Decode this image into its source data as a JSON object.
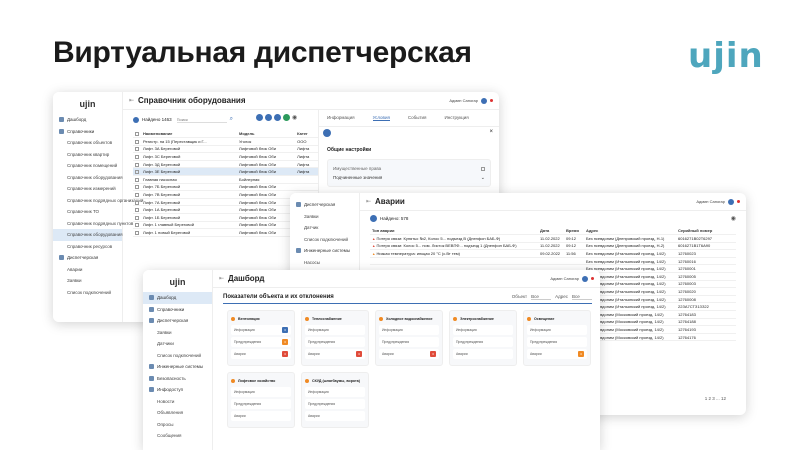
{
  "slide": {
    "title": "Виртуальная диспетчерская",
    "logo": "ujin"
  },
  "colors": {
    "accent": "#3d6fb4",
    "brand": "#4ea6bd",
    "orange": "#f08a24",
    "red": "#e04b3a",
    "blue": "#3d6fb4"
  },
  "w1": {
    "logo": "ujin",
    "title": "Справочник оборудования",
    "user": "Админ Сапогар",
    "search_label": "Найдено 1463",
    "search_placeholder": "Поиск",
    "sidebar": [
      {
        "label": "Дашборд",
        "icon": "dashboard-icon",
        "sub": false,
        "active": false
      },
      {
        "label": "Справочники",
        "icon": "book-icon",
        "sub": false,
        "active": false
      },
      {
        "label": "Справочник объектов",
        "sub": true,
        "active": false
      },
      {
        "label": "Справочник квартир",
        "sub": true,
        "active": false
      },
      {
        "label": "Справочник помещений",
        "sub": true,
        "active": false
      },
      {
        "label": "Справочник оборудования",
        "sub": true,
        "active": false
      },
      {
        "label": "Справочник измерений",
        "sub": true,
        "active": false
      },
      {
        "label": "Справочник подрядных организаций",
        "sub": true,
        "active": false
      },
      {
        "label": "Справочник ТО",
        "sub": true,
        "active": false
      },
      {
        "label": "Справочник подрядных пунктов",
        "sub": true,
        "active": false
      },
      {
        "label": "Справочник оборудования",
        "sub": true,
        "active": true
      },
      {
        "label": "Справочник ресурсов",
        "sub": true,
        "active": false
      },
      {
        "label": "Диспетчерская",
        "icon": "monitor-icon",
        "sub": false,
        "active": false
      },
      {
        "label": "Аварии",
        "sub": true,
        "active": false
      },
      {
        "label": "Заявки",
        "sub": true,
        "active": false
      },
      {
        "label": "Список подключений",
        "sub": true,
        "active": false
      }
    ],
    "columns": [
      "Наименование",
      "Модель",
      "Катег"
    ],
    "rows": [
      [
        "Регистр. на 15 (Переставщик и Г...",
        "Уголок",
        "ООО"
      ],
      [
        "Лифт. 3А Береговой",
        "Лифтовой блок Оби",
        "Лифта"
      ],
      [
        "Лифт. 3С Береговой",
        "Лифтовой блок Оби",
        "Лифта"
      ],
      [
        "Лифт. 3Д Береговой",
        "Лифтовой блок Оби",
        "Лифта"
      ],
      [
        "Лифт. 3Е Береговой",
        "Лифтовой блок Оби",
        "Лифта"
      ],
      [
        "Главная насосная",
        "Бойлерная",
        ""
      ],
      [
        "Лифт. 7Б Береговой",
        "Лифтовой блок Оби",
        ""
      ],
      [
        "Лифт. 7В Береговой",
        "Лифтовой блок Оби",
        ""
      ],
      [
        "Лифт. 7А Береговой",
        "Лифтовой блок Оби",
        ""
      ],
      [
        "Лифт. 1А Береговой",
        "Лифтовой блок Оби",
        ""
      ],
      [
        "Лифт. 1Б Береговой",
        "Лифтовой блок Оби",
        ""
      ],
      [
        "Лифт. 1 главный Береговой",
        "Лифтовой блок Оби",
        ""
      ],
      [
        "Лифт. 1 новый Береговой",
        "Лифтовой блок Оби",
        ""
      ]
    ],
    "panel": {
      "tabs": [
        "Информация",
        "Условия",
        "События",
        "Инструкция"
      ],
      "heading": "Общие настройки",
      "field1": "Имущественные права",
      "field2": "Подчиненные значения"
    }
  },
  "w2": {
    "title": "Аварии",
    "user": "Админ Сапогар",
    "found": "Найдено: 578",
    "sidebar": [
      {
        "label": "Диспетчерская",
        "sub": false
      },
      {
        "label": "Заявки",
        "sub": true
      },
      {
        "label": "Датчик",
        "sub": true
      },
      {
        "label": "Список подключений",
        "sub": true
      },
      {
        "label": "Инженерные системы",
        "sub": false
      },
      {
        "label": "Насосы",
        "sub": true
      }
    ],
    "columns": [
      "Тип аварии",
      "Дата",
      "Время",
      "Адрес",
      "Серийный номер"
    ],
    "rows": [
      [
        "Потеря связи: Кунятьо №2, Колос 5... подъезд В (Днепфон БАБ-Ф)",
        "11.02.2022",
        "09:12",
        "Без псевдоним (Днепровский проезд, Н-1)",
        "6016271В02Т6297"
      ],
      [
        "Потеря связи: Колос 5... пом. Листок ВЕВПФ... подъезд 1 (Днепфон БАБ-Ф)",
        "11.02.2022",
        "09:12",
        "Без псевдоним (Днепровский проезд, Н-2)",
        "6016271В1Т6А90"
      ],
      [
        "Низкая температура: инкцая 20 °C (с.Вт тем)",
        "09.02.2022",
        "11:56",
        "Без псевдоним (Итальянский проезд, 14/2)",
        "12760023"
      ],
      [
        "",
        "",
        "",
        "Без псевдоним (Итальянский проезд, 14/2)",
        "12760016"
      ],
      [
        "",
        "",
        "",
        "Без псевдоним (Итальянский проезд, 14/2)",
        "12760001"
      ],
      [
        "",
        "",
        "",
        "Без псевдоним (Итальянский проезд, 14/2)",
        "12760005"
      ],
      [
        "",
        "",
        "",
        "Без псевдоним (Итальянский проезд, 14/2)",
        "12760003"
      ],
      [
        "",
        "",
        "",
        "Без псевдоним (Итальянский проезд, 14/2)",
        "12760020"
      ],
      [
        "",
        "",
        "",
        "Без псевдоним (Итальянский проезд, 14/2)",
        "12760008"
      ],
      [
        "",
        "",
        "",
        "Без псевдоним (Итальянский проезд, 14/2)",
        "22ЗА7СТЗ1ЗЗ22"
      ],
      [
        "",
        "",
        "",
        "Без псевдоним (Московский проезд, 14/2)",
        "12764183"
      ],
      [
        "",
        "",
        "",
        "Без псевдоним (Московский проезд, 14/2)",
        "12764188"
      ],
      [
        "",
        "",
        "",
        "Без псевдоним (Московский проезд, 14/2)",
        "12764193"
      ],
      [
        "",
        "",
        "",
        "Без псевдоним (Московский проезд, 14/2)",
        "12764176"
      ]
    ],
    "pager": "1 2 3 ... 12"
  },
  "w3": {
    "logo": "ujin",
    "title": "Дашборд",
    "user": "Админ Сапогар",
    "heading": "Показатели объекта и их отклонения",
    "filter1_label": "Объект",
    "filter1_value": "Все",
    "filter2_label": "Адрес",
    "filter2_value": "Все",
    "sidebar": [
      {
        "label": "Дашборд",
        "sub": false,
        "active": true
      },
      {
        "label": "Справочники",
        "sub": false,
        "active": false
      },
      {
        "label": "Диспетчерская",
        "sub": false,
        "active": false
      },
      {
        "label": "Заявки",
        "sub": true,
        "active": false
      },
      {
        "label": "Датчики",
        "sub": true,
        "active": false
      },
      {
        "label": "Список подключений",
        "sub": true,
        "active": false
      },
      {
        "label": "Инженерные системы",
        "sub": false,
        "active": false
      },
      {
        "label": "Безопасность",
        "sub": false,
        "active": false
      },
      {
        "label": "Инфодоступ",
        "sub": false,
        "active": false
      },
      {
        "label": "Новости",
        "sub": true,
        "active": false
      },
      {
        "label": "Объявления",
        "sub": true,
        "active": false
      },
      {
        "label": "Опросы",
        "sub": true,
        "active": false
      },
      {
        "label": "Сообщения",
        "sub": true,
        "active": false
      }
    ],
    "cards": [
      {
        "title": "Вентиляция",
        "rows": [
          {
            "label": "Информация",
            "badge": "blue",
            "val": "3"
          },
          {
            "label": "Предупреждения",
            "badge": "orange",
            "val": "3"
          },
          {
            "label": "Аварии",
            "badge": "red",
            "val": "3"
          }
        ]
      },
      {
        "title": "Теплоснабжение",
        "rows": [
          {
            "label": "Информация",
            "badge": "",
            "val": ""
          },
          {
            "label": "Предупреждения",
            "badge": "",
            "val": ""
          },
          {
            "label": "Аварии",
            "badge": "red",
            "val": "3"
          }
        ]
      },
      {
        "title": "Холодное водоснабжение",
        "rows": [
          {
            "label": "Информация",
            "badge": "",
            "val": ""
          },
          {
            "label": "Предупреждения",
            "badge": "",
            "val": ""
          },
          {
            "label": "Аварии",
            "badge": "red",
            "val": "3"
          }
        ]
      },
      {
        "title": "Электроснабжение",
        "rows": [
          {
            "label": "Информация",
            "badge": "",
            "val": ""
          },
          {
            "label": "Предупреждения",
            "badge": "",
            "val": ""
          },
          {
            "label": "Аварии",
            "badge": "",
            "val": ""
          }
        ]
      },
      {
        "title": "Освещение",
        "rows": [
          {
            "label": "Информация",
            "badge": "",
            "val": ""
          },
          {
            "label": "Предупреждения",
            "badge": "",
            "val": ""
          },
          {
            "label": "Аварии",
            "badge": "orange",
            "val": "3"
          }
        ]
      },
      {
        "title": "Лифтовое хозяйство",
        "rows": [
          {
            "label": "Информация",
            "badge": "",
            "val": ""
          },
          {
            "label": "Предупреждения",
            "badge": "",
            "val": ""
          },
          {
            "label": "Аварии",
            "badge": "",
            "val": ""
          }
        ]
      },
      {
        "title": "СКУД (шлагбаумы, ворота)",
        "rows": [
          {
            "label": "Информация",
            "badge": "",
            "val": ""
          },
          {
            "label": "Предупреждения",
            "badge": "",
            "val": ""
          },
          {
            "label": "Аварии",
            "badge": "",
            "val": ""
          }
        ]
      }
    ]
  }
}
